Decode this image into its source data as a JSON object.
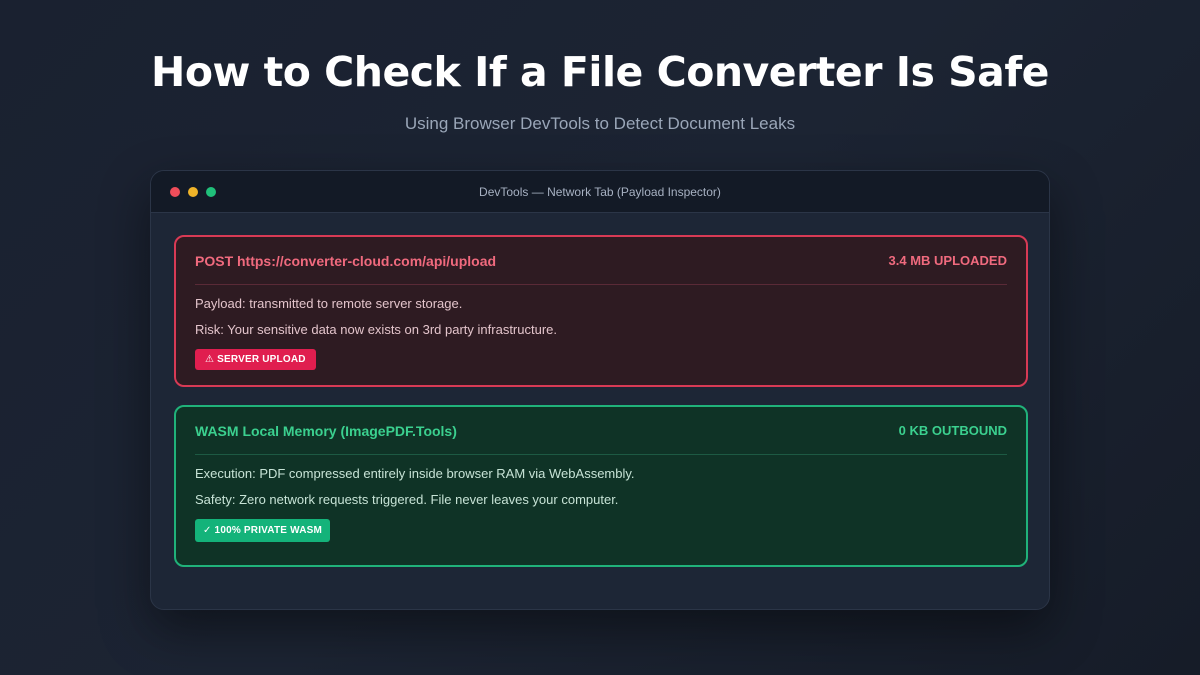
{
  "header": {
    "title": "How to Check If a File Converter Is Safe",
    "subtitle": "Using Browser DevTools to Detect Document Leaks"
  },
  "window": {
    "title": "DevTools — Network Tab (Payload Inspector)"
  },
  "danger_card": {
    "title": "POST https://converter-cloud.com/api/upload",
    "meta": "3.4 MB UPLOADED",
    "line1": "Payload:  transmitted to remote server storage.",
    "line2": "Risk: Your sensitive data now exists on 3rd party infrastructure.",
    "badge": "⚠ SERVER UPLOAD"
  },
  "safe_card": {
    "title": "WASM Local Memory (ImagePDF.Tools)",
    "meta": "0 KB OUTBOUND",
    "line1": "Execution: PDF compressed entirely inside browser RAM via WebAssembly.",
    "line2": "Safety: Zero network requests triggered. File never leaves your computer.",
    "badge": "✓ 100% PRIVATE WASM"
  }
}
